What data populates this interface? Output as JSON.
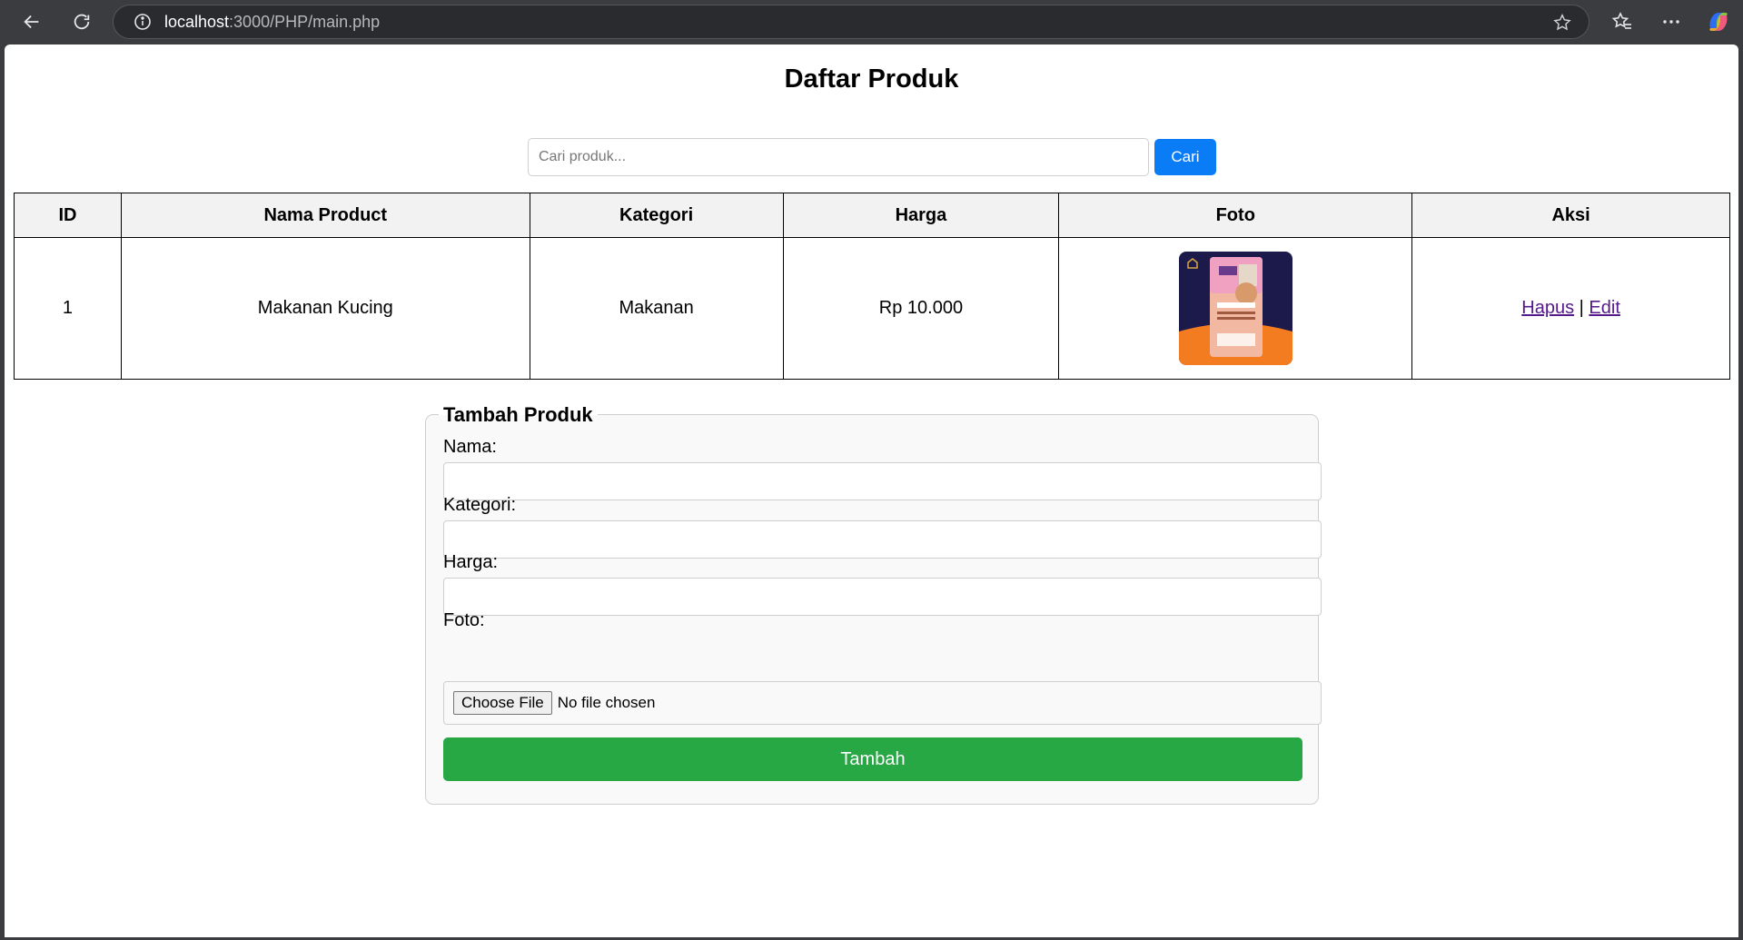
{
  "browser": {
    "url_host": "localhost",
    "url_rest": ":3000/PHP/main.php"
  },
  "page": {
    "title": "Daftar Produk"
  },
  "search": {
    "placeholder": "Cari produk...",
    "button": "Cari"
  },
  "table": {
    "headers": [
      "ID",
      "Nama Product",
      "Kategori",
      "Harga",
      "Foto",
      "Aksi"
    ],
    "rows": [
      {
        "id": "1",
        "nama": "Makanan Kucing",
        "kategori": "Makanan",
        "harga": "Rp 10.000",
        "foto": "cat-food-package-photo",
        "aksi_hapus": "Hapus",
        "aksi_sep": "|",
        "aksi_edit": "Edit"
      }
    ]
  },
  "form": {
    "legend": "Tambah Produk",
    "nama_label": "Nama:",
    "kategori_label": "Kategori:",
    "harga_label": "Harga:",
    "foto_label": "Foto:",
    "file_button": "Choose File",
    "file_status": "No file chosen",
    "submit": "Tambah"
  },
  "colors": {
    "search_button": "#0a7cf5",
    "submit_button": "#28a745",
    "header_bg": "#f2f2f2",
    "link": "#551a8b"
  }
}
